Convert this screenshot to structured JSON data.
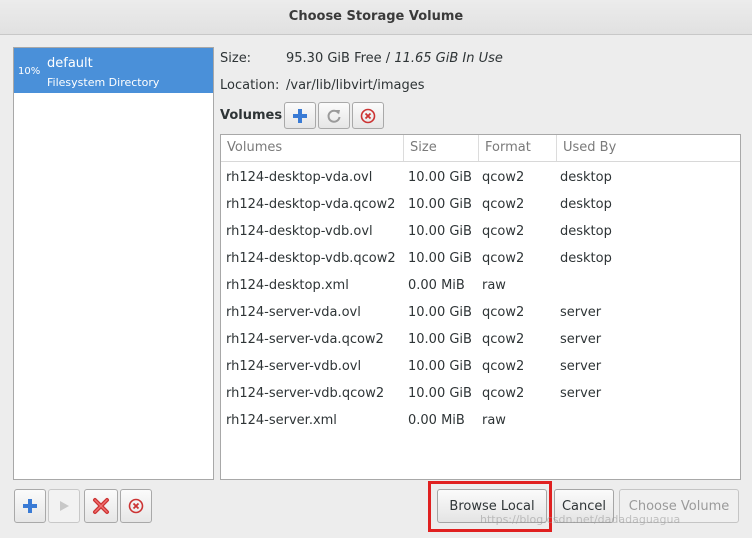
{
  "window": {
    "title": "Choose Storage Volume"
  },
  "pool": {
    "name": "default",
    "type": "Filesystem Directory",
    "usage": "10%"
  },
  "info": {
    "size_label": "Size:",
    "size_free": "95.30 GiB Free / ",
    "size_in_use": "11.65 GiB In Use",
    "location_label": "Location:",
    "location_value": "/var/lib/libvirt/images",
    "volumes_label": "Volumes"
  },
  "table": {
    "headers": [
      "Volumes",
      "Size",
      "Format",
      "Used By"
    ],
    "rows": [
      [
        "rh124-desktop-vda.ovl",
        "10.00 GiB",
        "qcow2",
        "desktop"
      ],
      [
        "rh124-desktop-vda.qcow2",
        "10.00 GiB",
        "qcow2",
        "desktop"
      ],
      [
        "rh124-desktop-vdb.ovl",
        "10.00 GiB",
        "qcow2",
        "desktop"
      ],
      [
        "rh124-desktop-vdb.qcow2",
        "10.00 GiB",
        "qcow2",
        "desktop"
      ],
      [
        "rh124-desktop.xml",
        "0.00 MiB",
        "raw",
        ""
      ],
      [
        "rh124-server-vda.ovl",
        "10.00 GiB",
        "qcow2",
        "server"
      ],
      [
        "rh124-server-vda.qcow2",
        "10.00 GiB",
        "qcow2",
        "server"
      ],
      [
        "rh124-server-vdb.ovl",
        "10.00 GiB",
        "qcow2",
        "server"
      ],
      [
        "rh124-server-vdb.qcow2",
        "10.00 GiB",
        "qcow2",
        "server"
      ],
      [
        "rh124-server.xml",
        "0.00 MiB",
        "raw",
        ""
      ]
    ]
  },
  "buttons": {
    "browse_local": "Browse Local",
    "cancel": "Cancel",
    "choose_volume": "Choose Volume"
  },
  "watermark": "https://blog.csdn.net/dadadaguagua",
  "colors": {
    "selection": "#4a90d9",
    "highlight_box": "#e02020",
    "add_icon": "#3a7bd5",
    "delete_icon": "#cc3333"
  }
}
